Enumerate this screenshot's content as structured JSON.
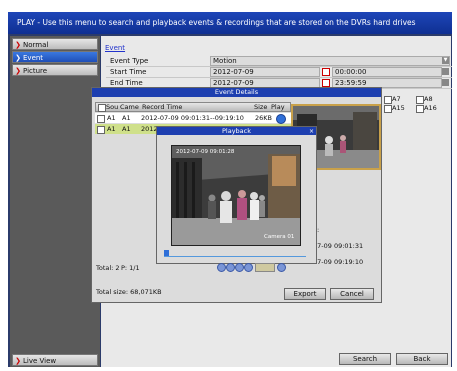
{
  "title_bar": {
    "text": "PLAY - Use this menu to search and playback events & recordings that are stored on the DVRs hard drives"
  },
  "sidebar": {
    "items": [
      {
        "label": "Normal"
      },
      {
        "label": "Event"
      },
      {
        "label": "Picture"
      }
    ],
    "bottom_item": {
      "label": "Live View"
    }
  },
  "main": {
    "section_link": "Event",
    "form": {
      "event_type": {
        "label": "Event Type",
        "value": "Motion"
      },
      "start_time": {
        "label": "Start Time",
        "date": "2012-07-09",
        "time": "00:00:00"
      },
      "end_time": {
        "label": "End Time",
        "date": "2012-07-09",
        "time": "23:59:59"
      }
    },
    "channels": [
      "A7",
      "A8",
      "A15",
      "A16"
    ],
    "buttons": {
      "search": "Search",
      "back": "Back"
    }
  },
  "event_details": {
    "title": "Event Details",
    "columns": [
      "Sou",
      "Came",
      "Record Time",
      "Size",
      "Play"
    ],
    "rows": [
      {
        "source": "A1",
        "camera": "A1",
        "record_time": "2012-07-09 09:01:31--09:19:10",
        "size": "26KB"
      },
      {
        "source": "A1",
        "camera": "A1",
        "record_time": "2012-0"
      }
    ],
    "total": "Total: 2",
    "page": "P: 1/1",
    "total_size": "Total size: 68,071KB",
    "side_times": {
      "label_partial": "e:",
      "start": "07-09 09:01:31",
      "end": "07-09 09:19:10"
    },
    "buttons": {
      "export": "Export",
      "cancel": "Cancel"
    }
  },
  "playback": {
    "title": "Playback",
    "osd_timestamp": "2012-07-09 09:01:28",
    "osd_camera": "Camera 01"
  }
}
